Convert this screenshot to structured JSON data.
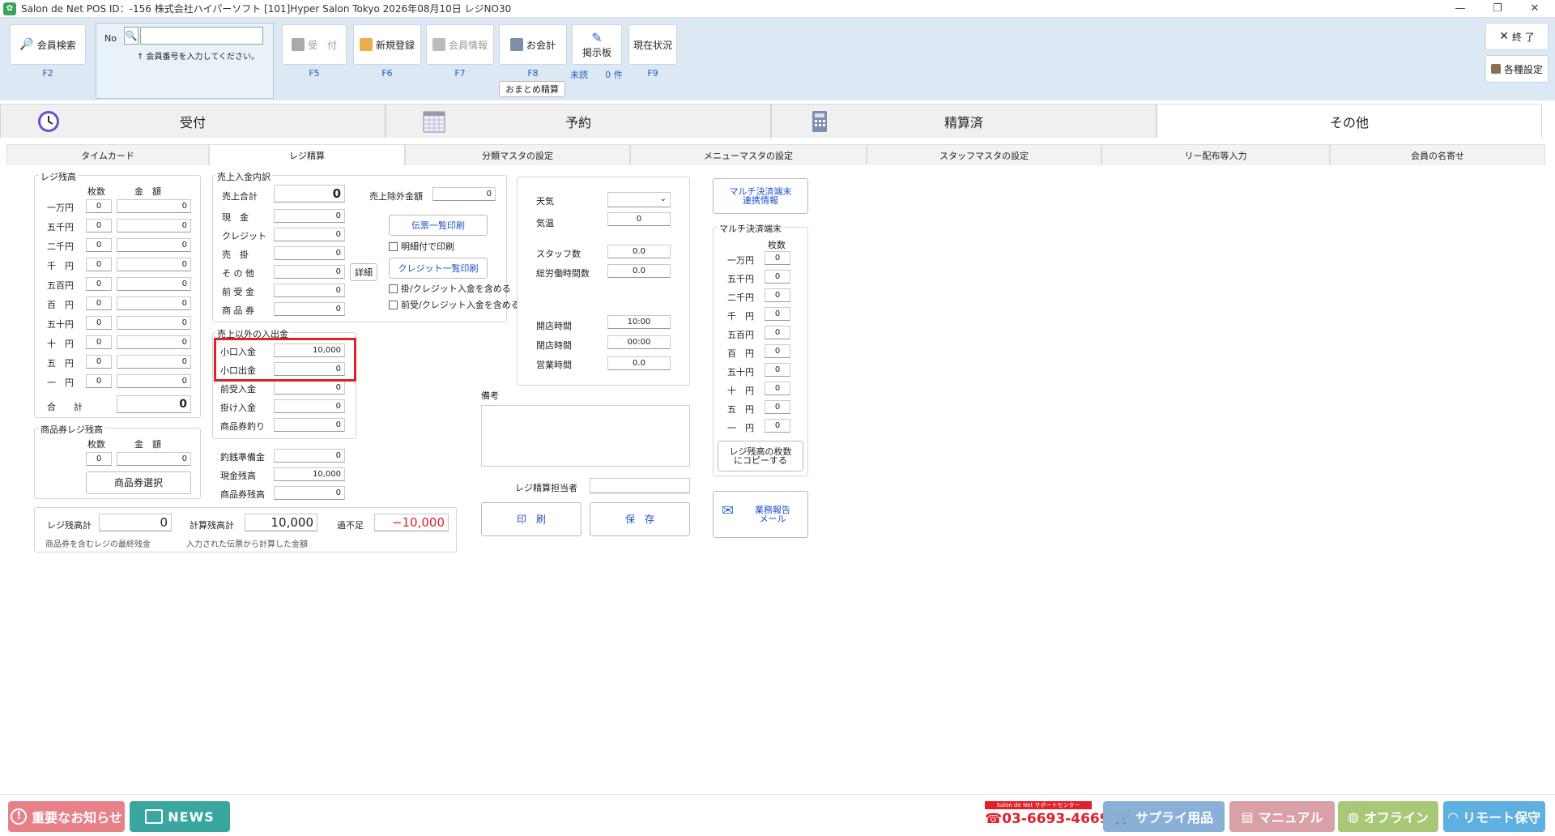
{
  "titlebar": {
    "text": "Salon de Net POS   ID：-156 株式会社ハイパーソフト   [101]Hyper Salon Tokyo   2026年08月10日   レジNO30",
    "min": "—",
    "max": "❐",
    "close": "✕"
  },
  "toolbar": {
    "member_search": "会員検索",
    "member_search_key": "F2",
    "no_label": "No",
    "member_no_hint": "↑ 会員番号を入力してください。",
    "member_no_value": "",
    "reception": "受　付",
    "reception_key": "F5",
    "new_register": "新規登録",
    "new_register_key": "F6",
    "member_info": "会員情報",
    "member_info_key": "F7",
    "checkout": "お会計",
    "checkout_key": "F8",
    "bulletin": "掲示板",
    "unread": "未読",
    "unread_count": "0 件",
    "status": "現在状況",
    "status_key": "F9",
    "bulk_settle": "おまとめ精算",
    "exit": "終 了",
    "settings": "各種設定"
  },
  "main_tabs": [
    {
      "label": "受付"
    },
    {
      "label": "予約"
    },
    {
      "label": "精算済"
    },
    {
      "label": "その他"
    }
  ],
  "sub_tabs": [
    {
      "label": "タイムカード"
    },
    {
      "label": "レジ精算"
    },
    {
      "label": "分類マスタの設定"
    },
    {
      "label": "メニューマスタの設定"
    },
    {
      "label": "スタッフマスタの設定"
    },
    {
      "label": "リー配布等入力"
    },
    {
      "label": "会員の名寄せ"
    }
  ],
  "register_cash": {
    "title": "レジ残高",
    "col_count": "枚数",
    "col_amount": "金　額",
    "rows": [
      {
        "label": "一万円",
        "count": "0",
        "amount": "0"
      },
      {
        "label": "五千円",
        "count": "0",
        "amount": "0"
      },
      {
        "label": "二千円",
        "count": "0",
        "amount": "0"
      },
      {
        "label": "千　円",
        "count": "0",
        "amount": "0"
      },
      {
        "label": "五百円",
        "count": "0",
        "amount": "0"
      },
      {
        "label": "百　円",
        "count": "0",
        "amount": "0"
      },
      {
        "label": "五十円",
        "count": "0",
        "amount": "0"
      },
      {
        "label": "十　円",
        "count": "0",
        "amount": "0"
      },
      {
        "label": "五　円",
        "count": "0",
        "amount": "0"
      },
      {
        "label": "一　円",
        "count": "0",
        "amount": "0"
      }
    ],
    "total_label": "合　　計",
    "total": "0"
  },
  "voucher": {
    "title": "商品券レジ残高",
    "col_count": "枚数",
    "col_amount": "金　額",
    "count": "0",
    "amount": "0",
    "select_btn": "商品券選択"
  },
  "sales": {
    "title": "売上入金内訳",
    "total_label": "売上合計",
    "total": "0",
    "excluded_label": "売上除外金額",
    "excluded": "0",
    "rows": [
      {
        "label": "現　金",
        "value": "0"
      },
      {
        "label": "クレジット",
        "value": "0"
      },
      {
        "label": "売　掛",
        "value": "0"
      },
      {
        "label": "そ の 他",
        "value": "0"
      },
      {
        "label": "前 受 金",
        "value": "0"
      },
      {
        "label": "商 品 券",
        "value": "0"
      }
    ],
    "detail_btn": "詳細",
    "slip_print_btn": "伝票一覧印刷",
    "detail_print_chk": "明細付で印刷",
    "credit_print_btn": "クレジット一覧印刷",
    "include_ar_chk": "掛/クレジット入金を含める",
    "include_adv_chk": "前受/クレジット入金を含める"
  },
  "other_io": {
    "title": "売上以外の入出金",
    "rows": [
      {
        "label": "小口入金",
        "value": "10,000"
      },
      {
        "label": "小口出金",
        "value": "0"
      },
      {
        "label": "前受入金",
        "value": "0"
      },
      {
        "label": "掛け入金",
        "value": "0"
      },
      {
        "label": "商品券釣り",
        "value": "0"
      }
    ]
  },
  "reserve": {
    "rows": [
      {
        "label": "釣銭準備金",
        "value": "0"
      },
      {
        "label": "現金残高",
        "value": "10,000"
      },
      {
        "label": "商品券残高",
        "value": "0"
      }
    ]
  },
  "summary": {
    "reg_total_label": "レジ残高計",
    "reg_total": "0",
    "reg_total_note": "商品券を含むレジの最終残金",
    "calc_total_label": "計算残高計",
    "calc_total": "10,000",
    "calc_total_note": "入力された伝票から計算した金額",
    "diff_label": "過不足",
    "diff": "−10,000"
  },
  "store_info": {
    "weather_label": "天気",
    "weather_value": "",
    "temp_label": "気温",
    "temp": "0",
    "staff_label": "スタッフ数",
    "staff": "0.0",
    "hours_label": "総労働時間数",
    "hours": "0.0",
    "open_label": "開店時間",
    "open": "10:00",
    "close_label": "閉店時間",
    "close": "00:00",
    "biz_label": "営業時間",
    "biz": "0.0"
  },
  "notes": {
    "label": "備考",
    "value": ""
  },
  "staff_in_charge": {
    "label": "レジ精算担当者",
    "value": ""
  },
  "actions": {
    "print": "印　刷",
    "save": "保　存"
  },
  "multi": {
    "link_btn": "マルチ決済端末\n連携情報",
    "title": "マルチ決済端末",
    "col_count": "枚数",
    "rows": [
      {
        "label": "一万円",
        "count": "0"
      },
      {
        "label": "五千円",
        "count": "0"
      },
      {
        "label": "二千円",
        "count": "0"
      },
      {
        "label": "千　円",
        "count": "0"
      },
      {
        "label": "五百円",
        "count": "0"
      },
      {
        "label": "百　円",
        "count": "0"
      },
      {
        "label": "五十円",
        "count": "0"
      },
      {
        "label": "十　円",
        "count": "0"
      },
      {
        "label": "五　円",
        "count": "0"
      },
      {
        "label": "一　円",
        "count": "0"
      }
    ],
    "copy_btn": "レジ残高の枚数\nにコピーする",
    "report_btn": "業務報告\nメール"
  },
  "bottom": {
    "important": "重要なお知らせ",
    "news": "NEWS",
    "support_caption": "Salon de Net サポートセンター",
    "support_phone": "03-6693-4669",
    "supply": "サプライ用品",
    "manual": "マニュアル",
    "offline": "オフライン",
    "remote": "リモート保守"
  },
  "colors": {
    "important": "#e8808a",
    "news": "#3aa6a0",
    "supply": "#8ab0d8",
    "manual": "#d9a0a8",
    "offline": "#a8c878",
    "remote": "#5eb0e0",
    "highlight": "#e0202a"
  }
}
